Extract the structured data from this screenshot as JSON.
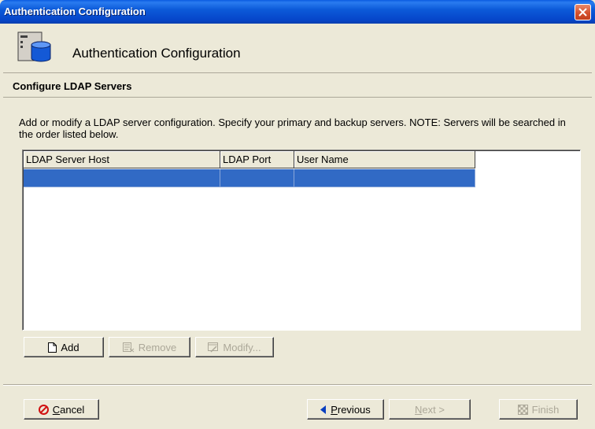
{
  "window": {
    "title": "Authentication Configuration"
  },
  "header": {
    "title": "Authentication Configuration"
  },
  "section": {
    "title": "Configure LDAP Servers"
  },
  "description": "Add or modify a LDAP server configuration.  Specify your primary and backup servers.  NOTE: Servers will be searched in the order listed below.",
  "table": {
    "columns": [
      "LDAP Server Host",
      "LDAP Port",
      "User Name"
    ],
    "rows": [
      [
        "",
        "",
        ""
      ]
    ]
  },
  "table_buttons": {
    "add": "Add",
    "remove": "Remove",
    "modify": "Modify..."
  },
  "footer_buttons": {
    "cancel_rest": "ancel",
    "cancel_mnemonic": "C",
    "previous_rest": "revious",
    "previous_mnemonic": "P",
    "next_rest": "ext >",
    "next_mnemonic": "N",
    "finish": "Finish"
  },
  "colors": {
    "titlebar": "#0a5be0",
    "selection": "#316ac5",
    "dialog_bg": "#ece9d8"
  }
}
